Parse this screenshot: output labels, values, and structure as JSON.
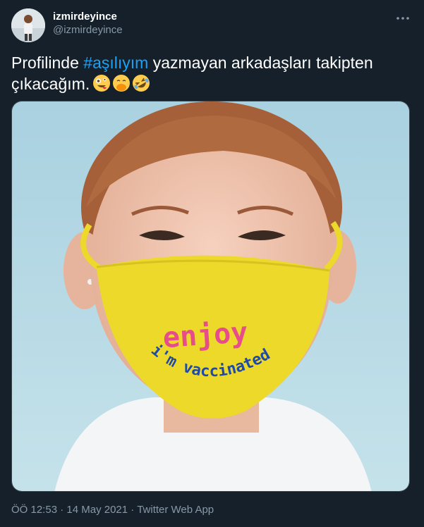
{
  "user": {
    "display_name": "izmirdeyince",
    "handle": "@izmirdeyince"
  },
  "tweet": {
    "text_before": "Profilinde ",
    "hashtag": "#aşılıyım",
    "text_after": " yazmayan arkadaşları takipten çıkacağım.",
    "emojis": [
      "zany-face",
      "face-with-hand-over-mouth",
      "rolling-on-the-floor-laughing"
    ]
  },
  "media": {
    "mask_text_1": "enjoy",
    "mask_text_2": "i'm vaccinated"
  },
  "meta": {
    "time": "ÖÖ 12:53",
    "separator": " · ",
    "date": "14 May 2021",
    "source": "Twitter Web App"
  },
  "colors": {
    "background": "#15202b",
    "accent": "#1da1f2",
    "secondary_text": "#8899a6",
    "mask_yellow": "#ecd92a"
  }
}
